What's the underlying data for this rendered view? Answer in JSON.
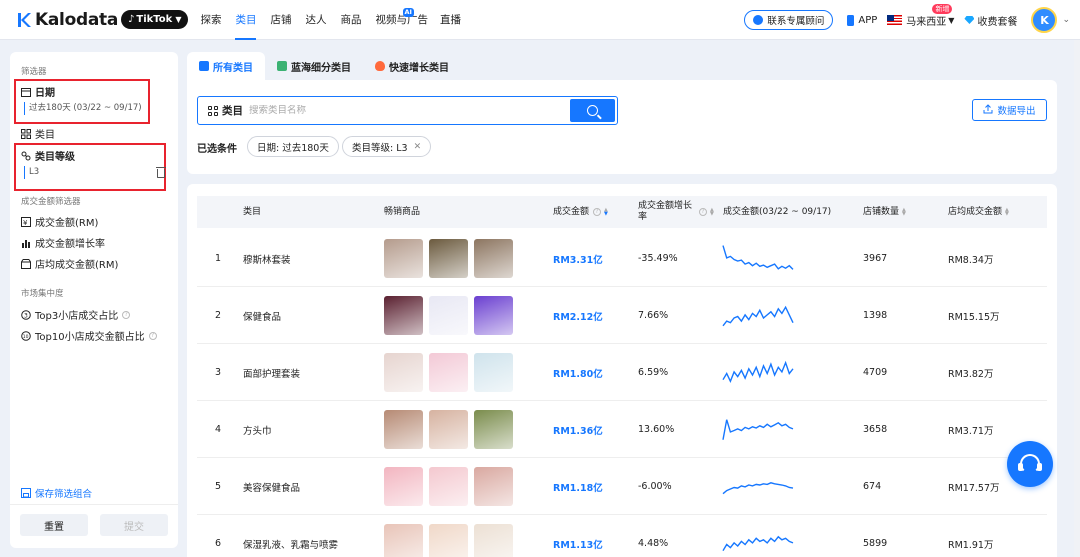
{
  "brand": {
    "name": "Kalodata",
    "platform": "TikTok"
  },
  "nav": {
    "items": [
      {
        "label": "探索"
      },
      {
        "label": "类目",
        "active": true
      },
      {
        "label": "店铺"
      },
      {
        "label": "达人"
      },
      {
        "label": "商品"
      },
      {
        "label": "视频与广告",
        "badge": "AI"
      },
      {
        "label": "直播"
      }
    ],
    "consult": "联系专属顾问",
    "app": "APP",
    "region": "马来西亚",
    "region_badge": "新增",
    "pricing": "收费套餐",
    "avatar_initial": "K"
  },
  "sidebar": {
    "filter_title": "筛选器",
    "date_label": "日期",
    "date_value": "过去180天 (03/22 ~ 09/17)",
    "category_label": "类目",
    "level_label": "类目等级",
    "level_value": "L3",
    "gmv_title": "成交金额筛选器",
    "gmv_items": [
      "成交金额(RM)",
      "成交金额增长率",
      "店均成交金额(RM)"
    ],
    "market_title": "市场集中度",
    "market_items": [
      "Top3小店成交占比",
      "Top10小店成交金额占比"
    ],
    "save_combo": "保存筛选组合",
    "reset": "重置",
    "submit": "提交"
  },
  "tabs": [
    {
      "label": "所有类目",
      "active": true
    },
    {
      "label": "蓝海细分类目"
    },
    {
      "label": "快速增长类目"
    }
  ],
  "filter": {
    "search_label": "类目",
    "search_placeholder": "搜索类目名称",
    "export": "数据导出",
    "chosen_label": "已选条件",
    "chips": [
      "日期: 过去180天",
      "类目等级: L3"
    ]
  },
  "table": {
    "headers": [
      "类目",
      "畅销商品",
      "成交金额",
      "成交金额增长率",
      "成交金额(03/22 ~ 09/17)",
      "店铺数量",
      "店均成交金额"
    ],
    "rows": [
      {
        "rank": "1",
        "category": "穆斯林套装",
        "gmv": "RM3.31亿",
        "growth": "-35.49%",
        "shops": "3967",
        "avg": "RM8.34万",
        "colors": [
          "#b49b8c",
          "#6b5a3e",
          "#8c7560"
        ],
        "trend": [
          0.95,
          0.55,
          0.6,
          0.5,
          0.45,
          0.48,
          0.35,
          0.4,
          0.3,
          0.38,
          0.28,
          0.32,
          0.25,
          0.3,
          0.35,
          0.2,
          0.28,
          0.22,
          0.3,
          0.18
        ]
      },
      {
        "rank": "2",
        "category": "保健食品",
        "gmv": "RM2.12亿",
        "growth": "7.66%",
        "shops": "1398",
        "avg": "RM15.15万",
        "colors": [
          "#5a2030",
          "#e8e8f4",
          "#6a3fd0"
        ],
        "trend": [
          0.2,
          0.35,
          0.3,
          0.45,
          0.5,
          0.35,
          0.55,
          0.4,
          0.6,
          0.5,
          0.7,
          0.45,
          0.55,
          0.65,
          0.5,
          0.75,
          0.6,
          0.8,
          0.55,
          0.3
        ]
      },
      {
        "rank": "3",
        "category": "面部护理套装",
        "gmv": "RM1.80亿",
        "growth": "6.59%",
        "shops": "4709",
        "avg": "RM3.82万",
        "colors": [
          "#e6d4cf",
          "#f3c9d6",
          "#cfe3ec"
        ],
        "trend": [
          0.3,
          0.5,
          0.25,
          0.55,
          0.4,
          0.6,
          0.35,
          0.65,
          0.45,
          0.7,
          0.4,
          0.75,
          0.5,
          0.8,
          0.45,
          0.7,
          0.55,
          0.85,
          0.5,
          0.65
        ]
      },
      {
        "rank": "4",
        "category": "方头巾",
        "gmv": "RM1.36亿",
        "growth": "13.60%",
        "shops": "3658",
        "avg": "RM3.71万",
        "colors": [
          "#b68a74",
          "#d6b2a0",
          "#7a8c4c"
        ],
        "trend": [
          0.2,
          0.85,
          0.45,
          0.5,
          0.55,
          0.5,
          0.6,
          0.55,
          0.62,
          0.58,
          0.65,
          0.6,
          0.7,
          0.62,
          0.68,
          0.75,
          0.65,
          0.7,
          0.6,
          0.55
        ]
      },
      {
        "rank": "5",
        "category": "美容保健食品",
        "gmv": "RM1.18亿",
        "growth": "-6.00%",
        "shops": "674",
        "avg": "RM17.57万",
        "colors": [
          "#f2b5c0",
          "#f4c8cf",
          "#d9a8a0"
        ],
        "trend": [
          0.3,
          0.4,
          0.45,
          0.5,
          0.48,
          0.55,
          0.52,
          0.58,
          0.55,
          0.6,
          0.58,
          0.62,
          0.6,
          0.65,
          0.62,
          0.6,
          0.58,
          0.55,
          0.5,
          0.48
        ]
      },
      {
        "rank": "6",
        "category": "保湿乳液、乳霜与喷雾",
        "gmv": "RM1.13亿",
        "growth": "4.48%",
        "shops": "5899",
        "avg": "RM1.91万",
        "colors": [
          "#e8c4b8",
          "#f0d8c8",
          "#ece0d4"
        ],
        "trend": [
          0.3,
          0.5,
          0.4,
          0.55,
          0.45,
          0.6,
          0.5,
          0.65,
          0.55,
          0.7,
          0.6,
          0.65,
          0.55,
          0.7,
          0.6,
          0.75,
          0.65,
          0.7,
          0.6,
          0.55
        ]
      }
    ]
  },
  "colors": {
    "accent": "#1677ff",
    "highlight_box": "#e8232e"
  }
}
